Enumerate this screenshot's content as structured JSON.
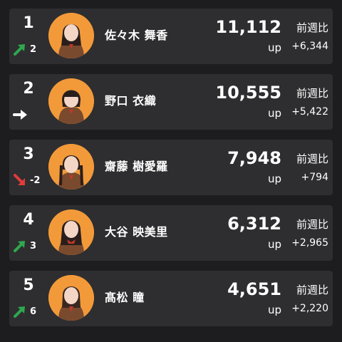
{
  "colors": {
    "background": "#1d1d1f",
    "card": "#2e2e30",
    "avatar_bg": "#f29a3a",
    "arrow_up": "#2fa84f",
    "arrow_down": "#e03b3b",
    "arrow_flat": "#ffffff"
  },
  "entries": [
    {
      "rank": "1",
      "change": "2",
      "trend": "up",
      "trend_icon": "arrow-up-right-icon",
      "name": "佐々木 舞香",
      "votes": "11,112",
      "unit": "up",
      "wow_label": "前週比",
      "wow": "+6,344"
    },
    {
      "rank": "2",
      "change": "",
      "trend": "flat",
      "trend_icon": "arrow-right-icon",
      "name": "野口 衣織",
      "votes": "10,555",
      "unit": "up",
      "wow_label": "前週比",
      "wow": "+5,422"
    },
    {
      "rank": "3",
      "change": "-2",
      "trend": "down",
      "trend_icon": "arrow-down-right-icon",
      "name": "齋藤 樹愛羅",
      "votes": "7,948",
      "unit": "up",
      "wow_label": "前週比",
      "wow": "+794"
    },
    {
      "rank": "4",
      "change": "3",
      "trend": "up",
      "trend_icon": "arrow-up-right-icon",
      "name": "大谷 映美里",
      "votes": "6,312",
      "unit": "up",
      "wow_label": "前週比",
      "wow": "+2,965"
    },
    {
      "rank": "5",
      "change": "6",
      "trend": "up",
      "trend_icon": "arrow-up-right-icon",
      "name": "髙松 瞳",
      "votes": "4,651",
      "unit": "up",
      "wow_label": "前週比",
      "wow": "+2,220"
    }
  ]
}
